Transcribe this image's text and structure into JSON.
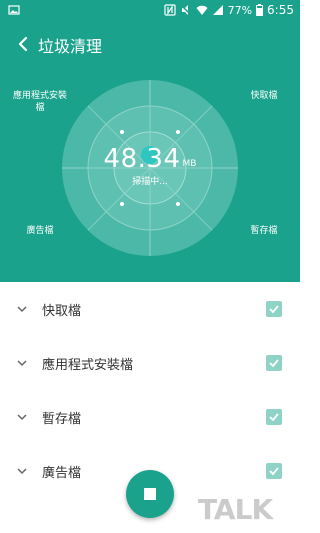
{
  "status_bar": {
    "battery": "77%",
    "time": "6:55",
    "icons": [
      "image-icon",
      "nfc-icon",
      "mute-icon",
      "wifi-icon",
      "signal-icon",
      "battery-icon"
    ]
  },
  "app_bar": {
    "title": "垃圾清理",
    "back_icon": "chevron-left-icon"
  },
  "scan": {
    "value": "48.34",
    "unit": "MB",
    "status": "掃描中...",
    "labels": {
      "top_left_line1": "應用程式安裝",
      "top_left_line2": "檔",
      "top_right": "快取檔",
      "bottom_left": "廣告檔",
      "bottom_right": "暫存檔"
    }
  },
  "list": {
    "items": [
      {
        "label": "快取檔",
        "checked": true
      },
      {
        "label": "應用程式安裝檔",
        "checked": true
      },
      {
        "label": "暫存檔",
        "checked": true
      },
      {
        "label": "廣告檔",
        "checked": true
      }
    ]
  },
  "fab": {
    "icon": "stop-icon"
  },
  "watermark": {
    "text": "TALK"
  },
  "colors": {
    "primary": "#1aa28d",
    "check": "#8fd3c7"
  }
}
